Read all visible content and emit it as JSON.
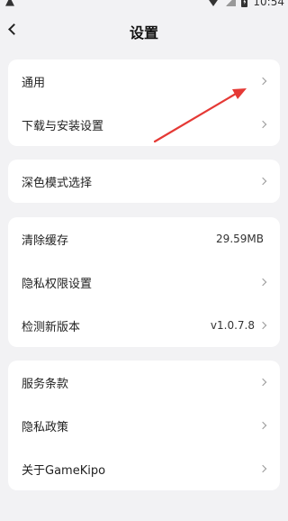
{
  "status_bar": {
    "time": "10:54"
  },
  "header": {
    "title": "设置"
  },
  "groups": [
    {
      "items": [
        {
          "label": "通用"
        },
        {
          "label": "下载与安装设置"
        }
      ]
    },
    {
      "items": [
        {
          "label": "深色模式选择"
        }
      ]
    },
    {
      "items": [
        {
          "label": "清除缓存",
          "value": "29.59MB"
        },
        {
          "label": "隐私权限设置"
        },
        {
          "label": "检测新版本",
          "value": "v1.0.7.8"
        }
      ]
    },
    {
      "items": [
        {
          "label": "服务条款"
        },
        {
          "label": "隐私政策"
        },
        {
          "label": "关于GameKipo"
        }
      ]
    }
  ],
  "annotation_color": "#e53935"
}
